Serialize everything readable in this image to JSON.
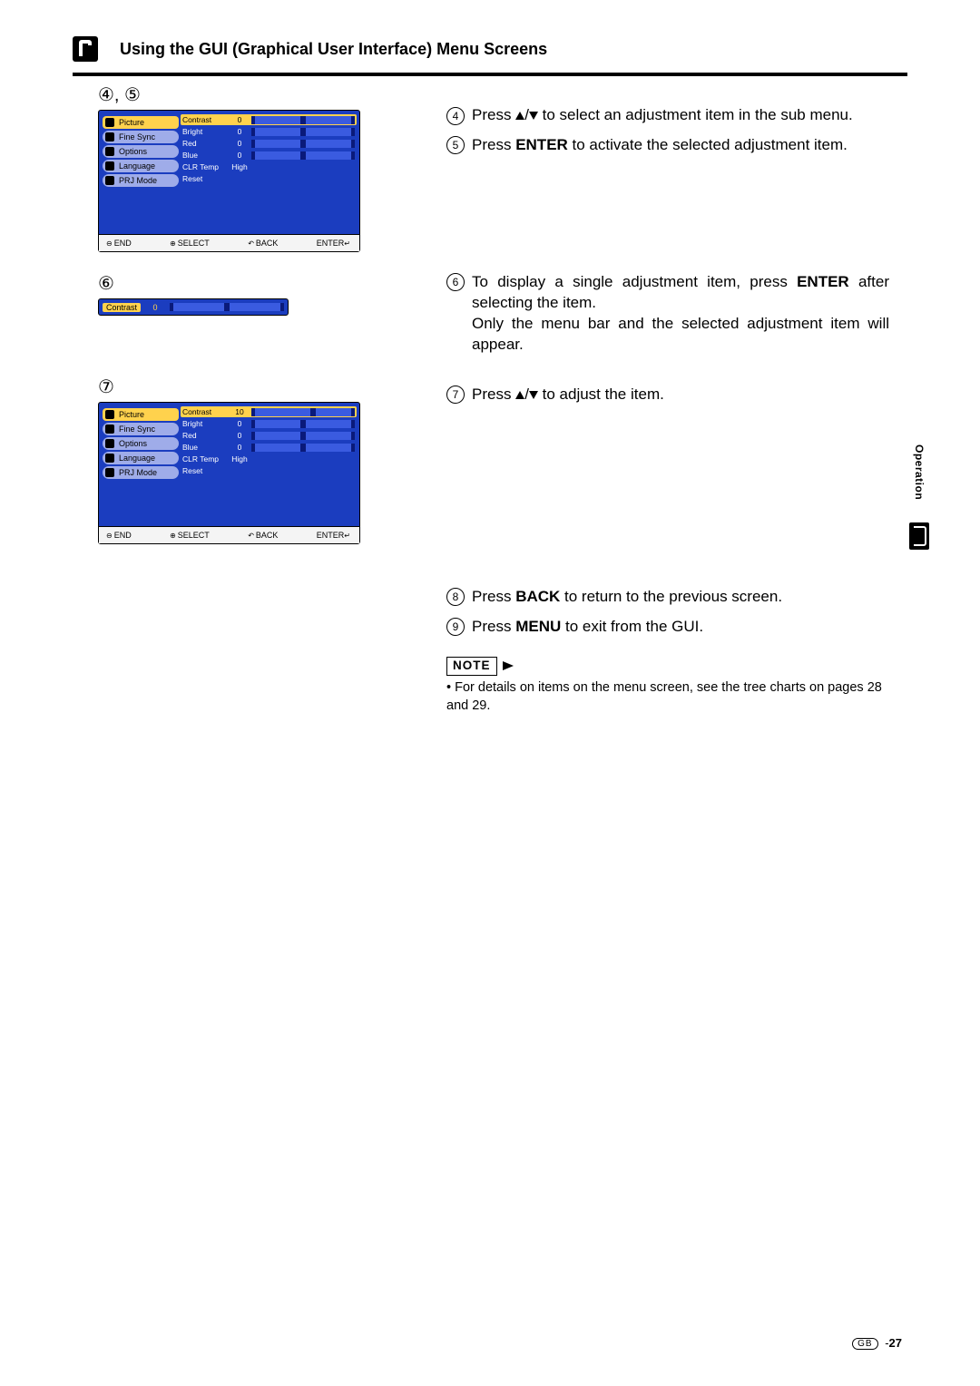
{
  "header": {
    "title": "Using the GUI (Graphical User Interface) Menu Screens"
  },
  "steps": {
    "label45": "④, ⑤",
    "label6": "⑥",
    "label7": "⑦"
  },
  "menu": {
    "items": [
      {
        "label": "Picture",
        "selected": true
      },
      {
        "label": "Fine Sync"
      },
      {
        "label": "Options"
      },
      {
        "label": "Language"
      },
      {
        "label": "PRJ Mode"
      }
    ]
  },
  "submenu": {
    "rows": [
      {
        "label": "Contrast",
        "value": "0",
        "bar": true,
        "selected": true
      },
      {
        "label": "Bright",
        "value": "0",
        "bar": true
      },
      {
        "label": "Red",
        "value": "0",
        "bar": true
      },
      {
        "label": "Blue",
        "value": "0",
        "bar": true
      },
      {
        "label": "CLR Temp",
        "value": "High"
      },
      {
        "label": "Reset",
        "value": ""
      }
    ]
  },
  "submenu7": {
    "rows": [
      {
        "label": "Contrast",
        "value": "10",
        "bar": true,
        "selected": true,
        "shift": true
      },
      {
        "label": "Bright",
        "value": "0",
        "bar": true
      },
      {
        "label": "Red",
        "value": "0",
        "bar": true
      },
      {
        "label": "Blue",
        "value": "0",
        "bar": true
      },
      {
        "label": "CLR Temp",
        "value": "High"
      },
      {
        "label": "Reset",
        "value": ""
      }
    ]
  },
  "single_bar": {
    "label": "Contrast",
    "value": "0"
  },
  "footer": {
    "end": "END",
    "select": "SELECT",
    "back": "BACK",
    "enter": "ENTER"
  },
  "instructions": {
    "i4a": "Press ",
    "i4b": " to select an adjustment item in the sub menu.",
    "i5a": "Press ",
    "i5b": "ENTER",
    "i5c": " to activate the selected adjustment item.",
    "i6a": "To display a single adjustment item, press ",
    "i6b": "ENTER",
    "i6c": " after selecting the item.",
    "i6d": "Only the menu bar and the selected adjustment item will appear.",
    "i7a": "Press ",
    "i7b": " to adjust the item.",
    "i8a": "Press ",
    "i8b": "BACK",
    "i8c": " to return to the previous screen.",
    "i9a": "Press ",
    "i9b": "MENU",
    "i9c": " to exit from the GUI."
  },
  "note": {
    "label": "NOTE",
    "bullet": "•",
    "text": "For details on items on the menu screen, see the tree charts on pages 28 and 29."
  },
  "side": {
    "label": "Operation"
  },
  "page": {
    "region": "GB",
    "num": "27"
  }
}
